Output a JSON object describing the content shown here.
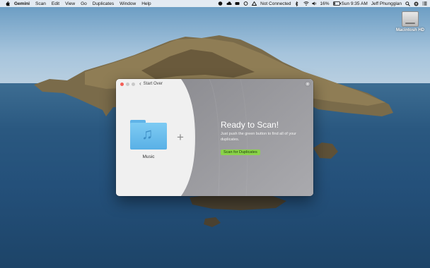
{
  "menubar": {
    "app": "Gemini",
    "menus": [
      "Scan",
      "Edit",
      "View",
      "Go",
      "Duplicates",
      "Window",
      "Help"
    ],
    "status": {
      "network": "Not Connected",
      "battery": "16%",
      "datetime": "Sun 9:35 AM",
      "user": "Jeff Phungglan"
    }
  },
  "desktop": {
    "drive_label": "Macintosh HD"
  },
  "window": {
    "start_over": "Start Over",
    "folder_label": "Music",
    "headline": "Ready to Scan!",
    "instructions": "Just push the green button to find all of your duplicates.",
    "scan_button": "Scan for Duplicates"
  },
  "colors": {
    "scan_button": "#8ad34a",
    "right_pane_top": "#8f8f94",
    "right_pane_bottom": "#a6a6aa",
    "close_button": "#f45f57",
    "folder": "#6cc0ef"
  }
}
